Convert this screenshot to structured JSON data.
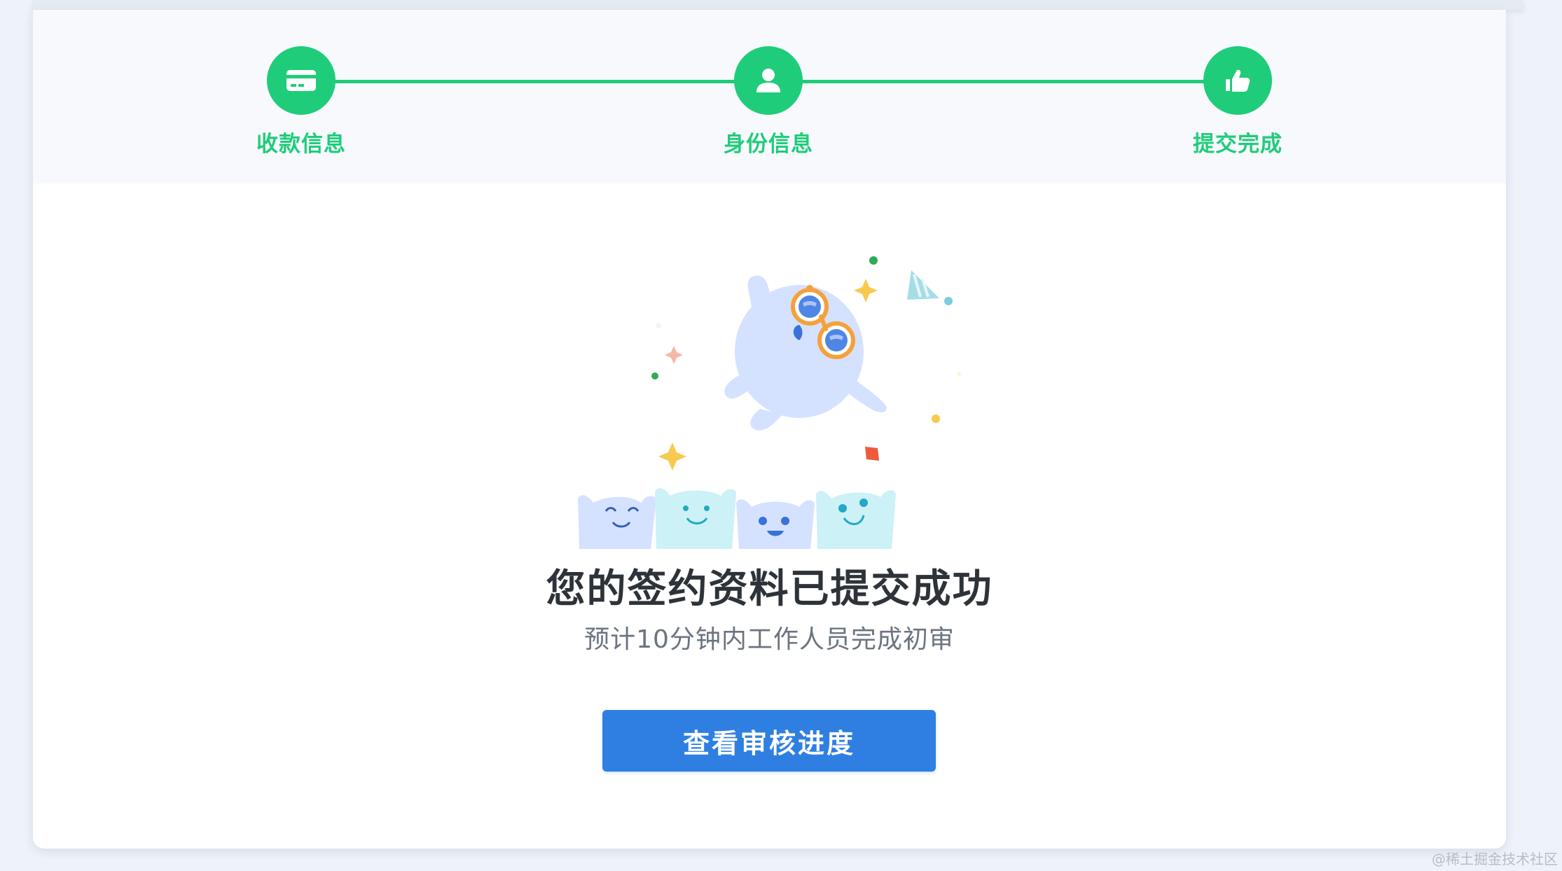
{
  "steps": [
    {
      "label": "收款信息",
      "icon": "credit-card-icon",
      "state": "done"
    },
    {
      "label": "身份信息",
      "icon": "user-icon",
      "state": "done"
    },
    {
      "label": "提交完成",
      "icon": "thumbs-up-icon",
      "state": "done"
    }
  ],
  "result": {
    "title": "您的签约资料已提交成功",
    "subtitle": "预计10分钟内工作人员完成初审",
    "button_label": "查看审核进度"
  },
  "watermark": "@稀土掘金技术社区",
  "colors": {
    "accent_green": "#1fcc7a",
    "primary_blue": "#2f7fe2",
    "title_text": "#2d3339",
    "subtitle_text": "#6c7480",
    "page_background": "#eef2f9"
  }
}
